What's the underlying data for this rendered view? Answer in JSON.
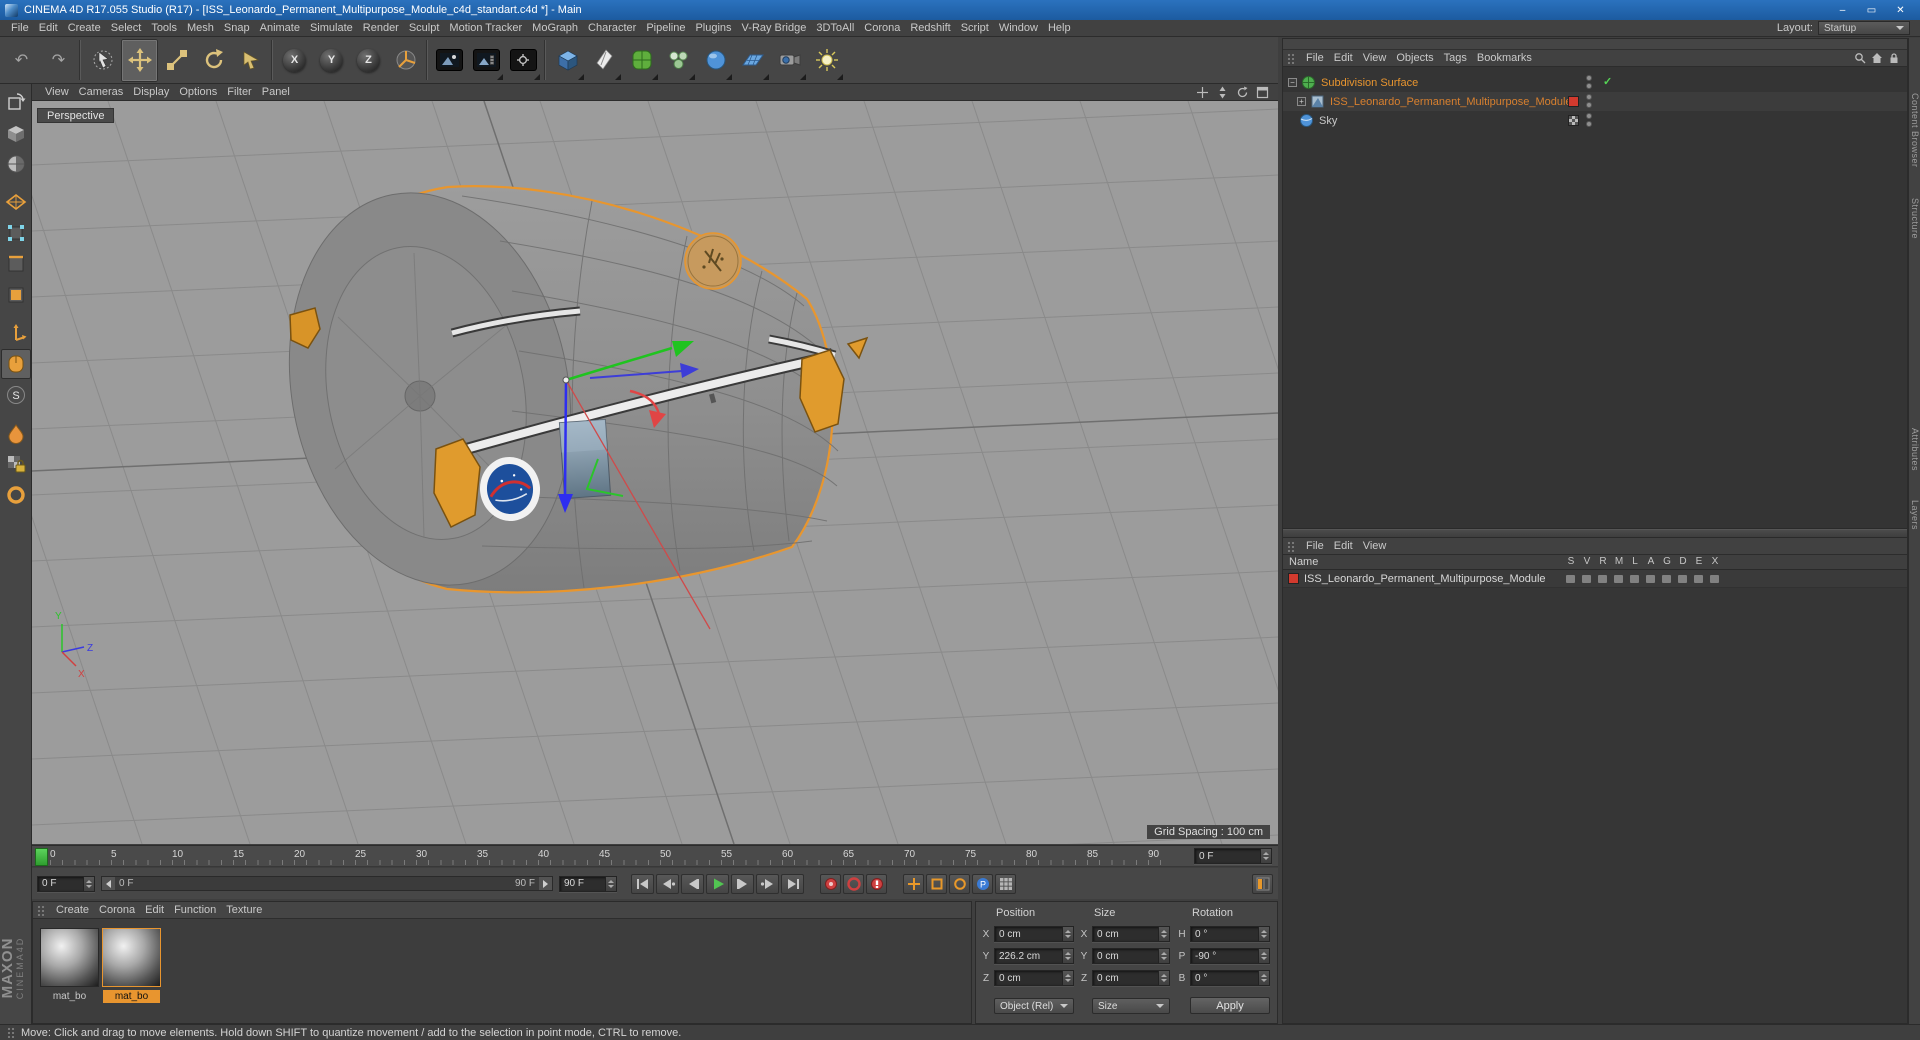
{
  "window": {
    "title": "CINEMA 4D R17.055 Studio (R17) - [ISS_Leonardo_Permanent_Multipurpose_Module_c4d_standart.c4d *] - Main",
    "min": "–",
    "max": "▭",
    "close": "✕"
  },
  "menubar": {
    "items": [
      "File",
      "Edit",
      "Create",
      "Select",
      "Tools",
      "Mesh",
      "Snap",
      "Animate",
      "Simulate",
      "Render",
      "Sculpt",
      "Motion Tracker",
      "MoGraph",
      "Character",
      "Pipeline",
      "Plugins",
      "V-Ray Bridge",
      "3DToAll",
      "Corona",
      "Redshift",
      "Script",
      "Window",
      "Help"
    ],
    "layout_label": "Layout:",
    "layout_value": "Startup"
  },
  "glyphs": {
    "undo": "↶",
    "redo": "↷",
    "minus": "−",
    "plus": "+",
    "check": "✓",
    "param": "P"
  },
  "toolbar": {
    "axis_x": "X",
    "axis_y": "Y",
    "axis_z": "Z"
  },
  "viewport_menu": {
    "items": [
      "View",
      "Cameras",
      "Display",
      "Options",
      "Filter",
      "Panel"
    ]
  },
  "viewport": {
    "camera_label": "Perspective",
    "grid_spacing": "Grid Spacing : 100 cm",
    "axis_x": "X",
    "axis_y": "Y",
    "axis_z": "Z"
  },
  "object_manager": {
    "menu": [
      "File",
      "Edit",
      "View",
      "Objects",
      "Tags",
      "Bookmarks"
    ],
    "objects": [
      {
        "name": "Subdivision Surface"
      },
      {
        "name": "ISS_Leonardo_Permanent_Multipurpose_Module"
      },
      {
        "name": "Sky"
      }
    ]
  },
  "layer_manager": {
    "menu": [
      "File",
      "Edit",
      "View"
    ],
    "name_header": "Name",
    "columns": [
      "S",
      "V",
      "R",
      "M",
      "L",
      "A",
      "G",
      "D",
      "E",
      "X"
    ],
    "rows": [
      {
        "name": "ISS_Leonardo_Permanent_Multipurpose_Module",
        "color": "#d23a2e"
      }
    ]
  },
  "side_tabs": {
    "upper": [
      "Content Browser",
      "Structure"
    ],
    "lower": [
      "Attributes",
      "Layers"
    ]
  },
  "timeline": {
    "ticks": [
      "0",
      "5",
      "10",
      "15",
      "20",
      "25",
      "30",
      "35",
      "40",
      "45",
      "50",
      "55",
      "60",
      "65",
      "70",
      "75",
      "80",
      "85",
      "90"
    ],
    "frame_spin": "0 F",
    "start_field": "0 F",
    "end_field": "90 F",
    "range_start": "0 F",
    "range_end": "90 F"
  },
  "materials": {
    "menu": [
      "Create",
      "Corona",
      "Edit",
      "Function",
      "Texture"
    ],
    "items": [
      {
        "label": "mat_bo"
      },
      {
        "label": "mat_bo"
      }
    ]
  },
  "coordinates": {
    "title_position": "Position",
    "title_size": "Size",
    "title_rotation": "Rotation",
    "pos": {
      "x_label": "X",
      "x": "0 cm",
      "y_label": "Y",
      "y": "226.2 cm",
      "z_label": "Z",
      "z": "0 cm"
    },
    "size": {
      "x_label": "X",
      "x": "0 cm",
      "y_label": "Y",
      "y": "0 cm",
      "z_label": "Z",
      "z": "0 cm"
    },
    "rot": {
      "h_label": "H",
      "h": "0 °",
      "p_label": "P",
      "p": "-90 °",
      "b_label": "B",
      "b": "0 °"
    },
    "object_mode": "Object (Rel)",
    "size_mode": "Size",
    "apply": "Apply"
  },
  "statusbar": {
    "text": "Move: Click and drag to move elements. Hold down SHIFT to quantize movement / add to the selection in point mode, CTRL to remove."
  },
  "branding": {
    "maxon": "MAXON",
    "cinema": "CINEMA4D"
  }
}
